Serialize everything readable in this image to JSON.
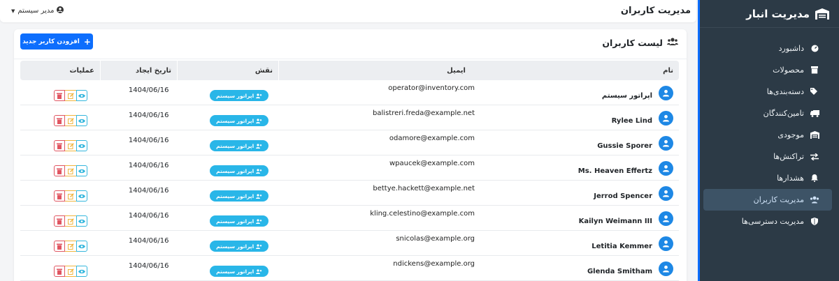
{
  "sidebar": {
    "brand": "مدیریت انبار",
    "items": [
      {
        "label": "داشبورد",
        "icon": "dashboard-icon",
        "active": false
      },
      {
        "label": "محصولات",
        "icon": "box-icon",
        "active": false
      },
      {
        "label": "دسته‌بندی‌ها",
        "icon": "tags-icon",
        "active": false
      },
      {
        "label": "تامین‌کنندگان",
        "icon": "truck-icon",
        "active": false
      },
      {
        "label": "موجودی",
        "icon": "warehouse-icon",
        "active": false
      },
      {
        "label": "تراکنش‌ها",
        "icon": "exchange-icon",
        "active": false
      },
      {
        "label": "هشدارها",
        "icon": "bell-icon",
        "active": false
      },
      {
        "label": "مدیریت کاربران",
        "icon": "users-icon",
        "active": true
      },
      {
        "label": "مدیریت دسترسی‌ها",
        "icon": "shield-icon",
        "active": false
      }
    ]
  },
  "header": {
    "title": "مدیریت کاربران",
    "user_label": "مدیر سیستم"
  },
  "card": {
    "title": "لیست کاربران",
    "add_button": "افزودن کاربر جدید"
  },
  "table": {
    "columns": {
      "name": "نام",
      "email": "ایمیل",
      "role": "نقش",
      "created": "تاریخ ایجاد",
      "ops": "عملیات"
    },
    "rows": [
      {
        "name": "اپراتور سیستم",
        "email": "operator@inventory.com",
        "role": "اپراتور سیستم",
        "created": "1404/06/16"
      },
      {
        "name": "Rylee Lind",
        "email": "balistreri.freda@example.net",
        "role": "اپراتور سیستم",
        "created": "1404/06/16"
      },
      {
        "name": "Gussie Sporer",
        "email": "odamore@example.com",
        "role": "اپراتور سیستم",
        "created": "1404/06/16"
      },
      {
        "name": "Ms. Heaven Effertz",
        "email": "wpaucek@example.com",
        "role": "اپراتور سیستم",
        "created": "1404/06/16"
      },
      {
        "name": "Jerrod Spencer",
        "email": "bettye.hackett@example.net",
        "role": "اپراتور سیستم",
        "created": "1404/06/16"
      },
      {
        "name": "Kailyn Weimann III",
        "email": "kling.celestino@example.com",
        "role": "اپراتور سیستم",
        "created": "1404/06/16"
      },
      {
        "name": "Letitia Kemmer",
        "email": "snicolas@example.org",
        "role": "اپراتور سیستم",
        "created": "1404/06/16"
      },
      {
        "name": "Glenda Smitham",
        "email": "ndickens@example.org",
        "role": "اپراتور سیستم",
        "created": "1404/06/16"
      }
    ]
  },
  "colors": {
    "primary": "#0d6efd",
    "sidebar": "#2c3a46",
    "badge": "#29b6e8",
    "danger": "#e05561",
    "warning": "#f0b43c",
    "info": "#33b6dd"
  }
}
